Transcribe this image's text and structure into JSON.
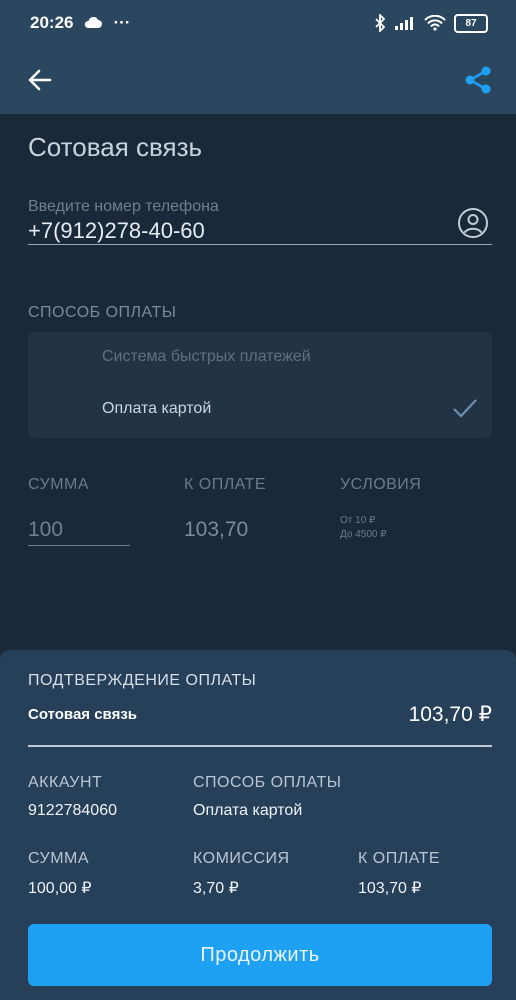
{
  "status_bar": {
    "time": "20:26",
    "dots": "···",
    "battery": "87"
  },
  "app_bar": {
    "back_icon": "arrow-left-icon",
    "share_icon": "share-icon",
    "accent": "#1ea1f2"
  },
  "page": {
    "title": "Сотовая связь"
  },
  "phone": {
    "hint": "Введите номер телефона",
    "value": "+7(912)278-40-60"
  },
  "payment_method": {
    "label": "СПОСОБ ОПЛАТЫ",
    "options": [
      "Система быстрых платежей",
      "Оплата картой"
    ],
    "selected": "Оплата картой"
  },
  "amount": {
    "sum_label": "СУММА",
    "sum_value": "100",
    "to_pay_label": "К ОПЛАТЕ",
    "to_pay_value": "103,70",
    "conditions_label": "УСЛОВИЯ",
    "conditions_min": "От 10 ₽",
    "conditions_max": "До 4500 ₽"
  },
  "confirmation": {
    "title": "ПОДТВЕРЖДЕНИЕ ОПЛАТЫ",
    "service": "Сотовая связь",
    "total": "103,70 ₽",
    "account_label": "АККАУНТ",
    "account_value": "9122784060",
    "method_label": "СПОСОБ ОПЛАТЫ",
    "method_value": "Оплата картой",
    "sum_label": "СУММА",
    "sum_value": "100,00 ₽",
    "fee_label": "КОМИССИЯ",
    "fee_value": "3,70 ₽",
    "to_pay_label": "К ОПЛАТЕ",
    "to_pay_value": "103,70 ₽",
    "continue_label": "Продолжить"
  }
}
